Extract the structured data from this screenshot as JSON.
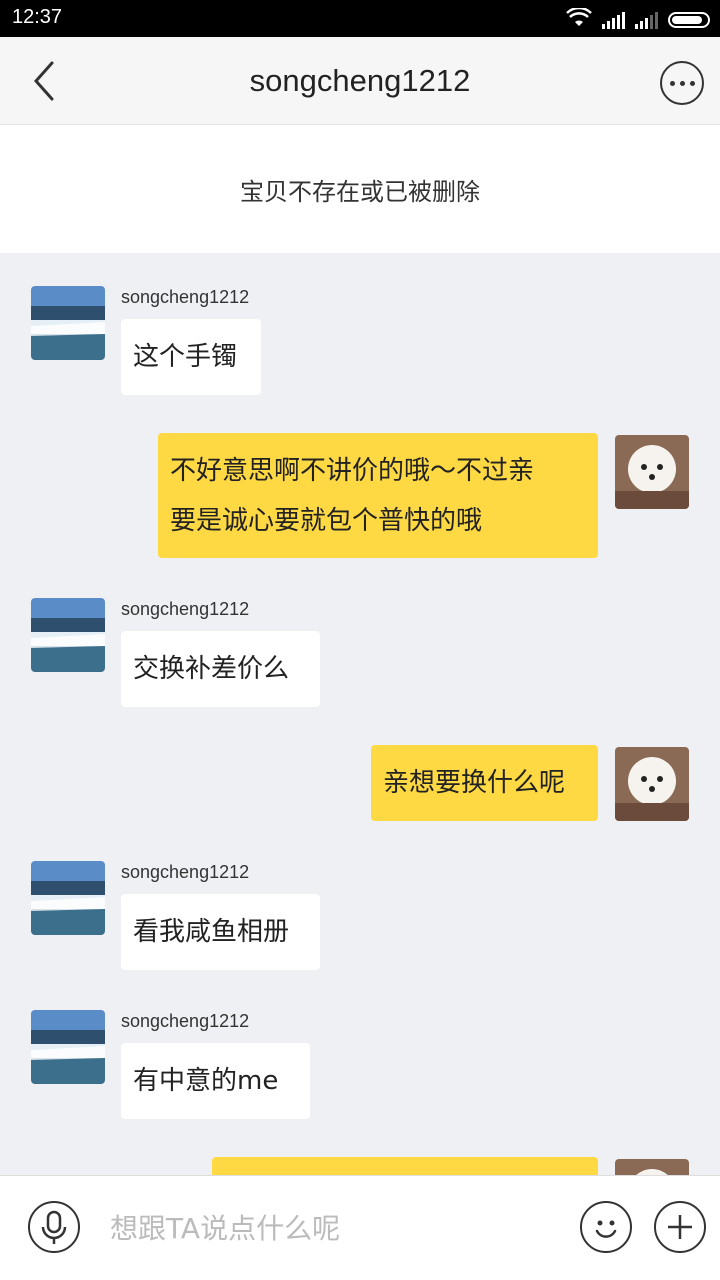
{
  "status_bar": {
    "time": "12:37",
    "icons": [
      "wifi-icon",
      "signal-icon",
      "signal-icon",
      "battery-icon"
    ]
  },
  "header": {
    "title": "songcheng1212",
    "back_icon": "chevron-left-icon",
    "more_icon": "more-dots-icon"
  },
  "notice": {
    "text": "宝贝不存在或已被删除"
  },
  "messages": [
    {
      "side": "left",
      "sender": "songcheng1212",
      "lines": [
        "这个手镯"
      ]
    },
    {
      "side": "right",
      "lines": [
        "不好意思啊不讲价的哦～不过亲",
        "要是诚心要就包个普快的哦"
      ]
    },
    {
      "side": "left",
      "sender": "songcheng1212",
      "lines": [
        "交换补差价么"
      ]
    },
    {
      "side": "right",
      "lines": [
        "亲想要换什么呢"
      ]
    },
    {
      "side": "left",
      "sender": "songcheng1212",
      "lines": [
        "看我咸鱼相册"
      ]
    },
    {
      "side": "left",
      "sender": "songcheng1212",
      "lines": [
        "有中意的me"
      ]
    },
    {
      "side": "right",
      "lines": [
        ""
      ]
    }
  ],
  "input_bar": {
    "placeholder": "想跟TA说点什么呢",
    "value": "",
    "mic_icon": "microphone-icon",
    "emoji_icon": "smiley-icon",
    "plus_icon": "plus-icon"
  },
  "colors": {
    "my_bubble": "#ffd944",
    "their_bubble": "#ffffff",
    "chat_bg": "#eff0f4"
  }
}
